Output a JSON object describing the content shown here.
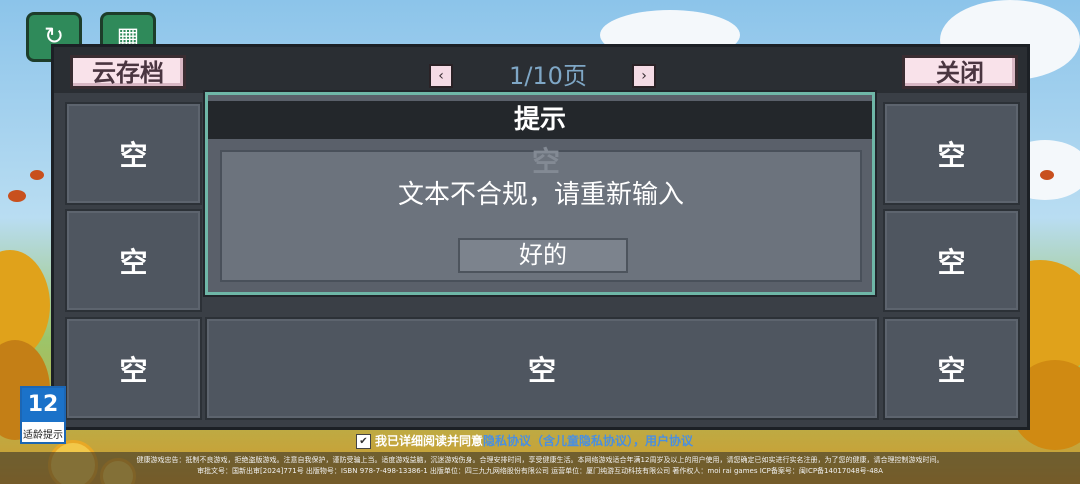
{
  "header": {
    "cloud_save_label": "云存档",
    "close_label": "关闭",
    "prev_icon": "‹",
    "next_icon": "›",
    "page_indicator": "1/10页"
  },
  "slots": {
    "empty_label": "空",
    "r1_left": "空",
    "r1_right": "空",
    "r2_left": "空",
    "r2_right": "空",
    "r3_left": "空",
    "r3_center": "空",
    "r3_right": "空"
  },
  "dialog": {
    "title": "提示",
    "ghost_label": "空",
    "message": "文本不合规，请重新输入",
    "ok_label": "好的"
  },
  "age_rating": {
    "number": "12",
    "label": "适龄提示"
  },
  "consent": {
    "text": "我已详细阅读并同意",
    "privacy_link": "隐私协议（含儿童隐私协议）",
    "separator": "，",
    "user_link": "用户协议"
  },
  "footer": {
    "line1": "健康游戏忠告：抵制不良游戏，拒绝盗版游戏。注意自我保护，谨防受骗上当。适度游戏益脑，沉迷游戏伤身。合理安排时间，享受健康生活。本网络游戏适合年满12周岁及以上的用户使用，请您确定已如实进行实名注册，为了您的健康，请合理控制游戏时间。",
    "line2": "审批文号：国新出审[2024]771号 出版物号：ISBN 978-7-498-13386-1 出版单位：四三九九网络股份有限公司 运营单位：厦门纯游互动科技有限公司 著作权人：moi rai games ICP备案号：闽ICP备14017048号-48A"
  },
  "colors": {
    "panel": "#3a3f46",
    "dialog_border": "#6fb7a8",
    "button_bg": "#f9e2ea",
    "link": "#4a8fe0"
  }
}
